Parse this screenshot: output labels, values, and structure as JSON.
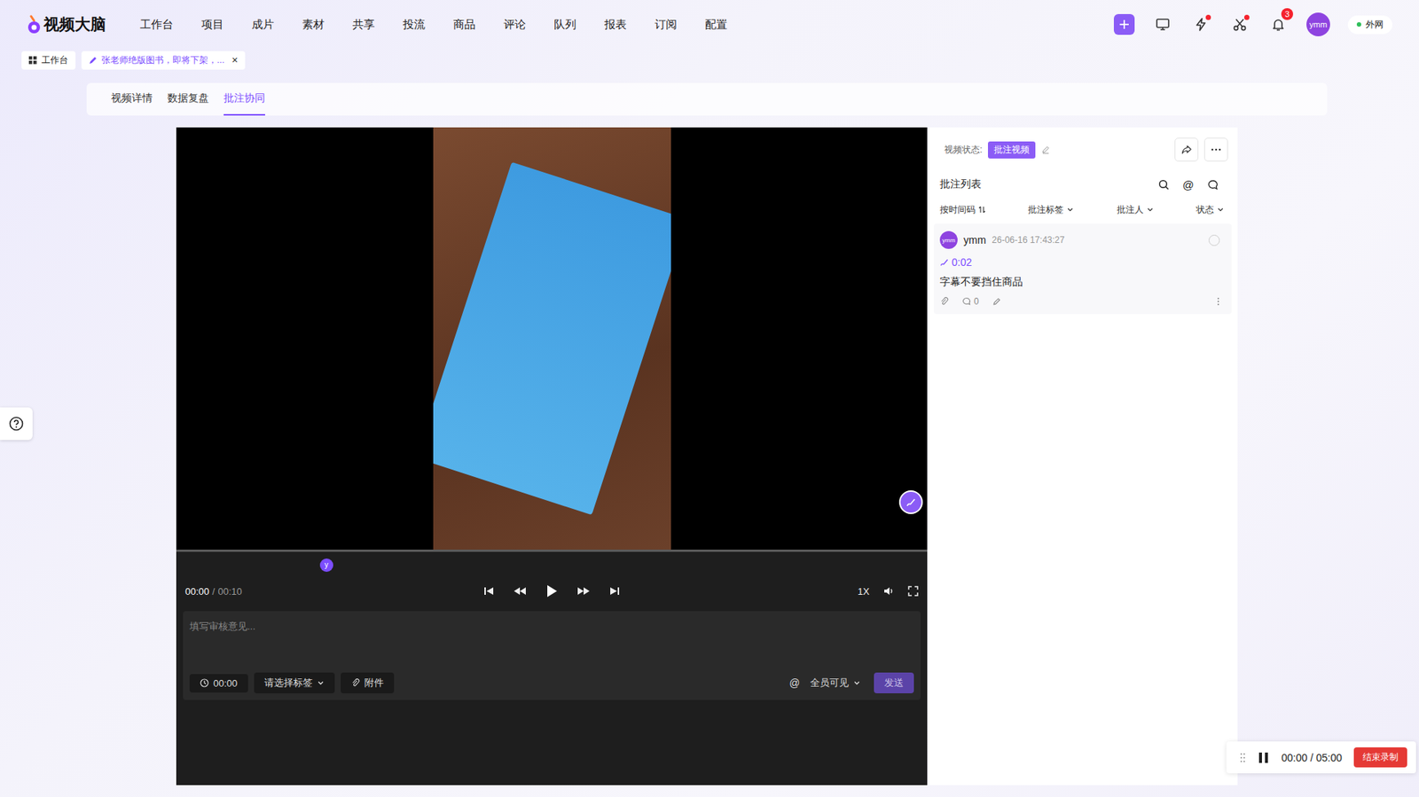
{
  "app": {
    "logo": "视频大脑",
    "nav": [
      "工作台",
      "项目",
      "成片",
      "素材",
      "共享",
      "投流",
      "商品",
      "评论",
      "队列",
      "报表",
      "订阅",
      "配置"
    ],
    "alerts": {
      "lightning": true,
      "scissors": true
    },
    "notification_count": "3",
    "user": "ymm",
    "network": "外网",
    "network_online": true
  },
  "breadcrumbs": [
    {
      "label": "工作台",
      "selected": false,
      "closable": false
    },
    {
      "label": "张老师绝版图书，即将下架，...",
      "selected": true,
      "closable": true
    }
  ],
  "close_icon": "×",
  "subtabs": [
    {
      "label": "视频详情",
      "selected": false
    },
    {
      "label": "数据复盘",
      "selected": false
    },
    {
      "label": "批注协同",
      "selected": true
    }
  ],
  "player": {
    "current": "00:00",
    "separator": "/",
    "duration": "00:10",
    "progress": {
      "level": 0
    },
    "markers": [
      {
        "label": "y",
        "level": 0.2
      }
    ],
    "speed": "1X",
    "playing": false
  },
  "composer": {
    "placeholder": "填写审核意见...",
    "timecode": "00:00",
    "tag_placeholder": "请选择标签",
    "attach": "附件",
    "mention": "@",
    "visibility": "全员可见",
    "send": "发送",
    "send_disabled": true
  },
  "panel": {
    "status_label": "视频状态:",
    "status": "批注视频",
    "title": "批注列表",
    "mention": "@",
    "filters": [
      {
        "label": "按时间码",
        "kind": "sort"
      },
      {
        "label": "批注标签",
        "kind": "dropdown"
      },
      {
        "label": "批注人",
        "kind": "dropdown"
      },
      {
        "label": "状态",
        "kind": "dropdown"
      }
    ],
    "annotations": [
      {
        "avatar": "ymm",
        "author": "ymm",
        "time": "26-06-16 17:43:27",
        "timecode": "0:02",
        "text": "字幕不要挡住商品",
        "replies": "0",
        "resolved": false
      }
    ]
  },
  "recording": {
    "elapsed": "00:00",
    "separator": "/",
    "limit": "05:00",
    "stop": "结束录制",
    "recording": true
  }
}
